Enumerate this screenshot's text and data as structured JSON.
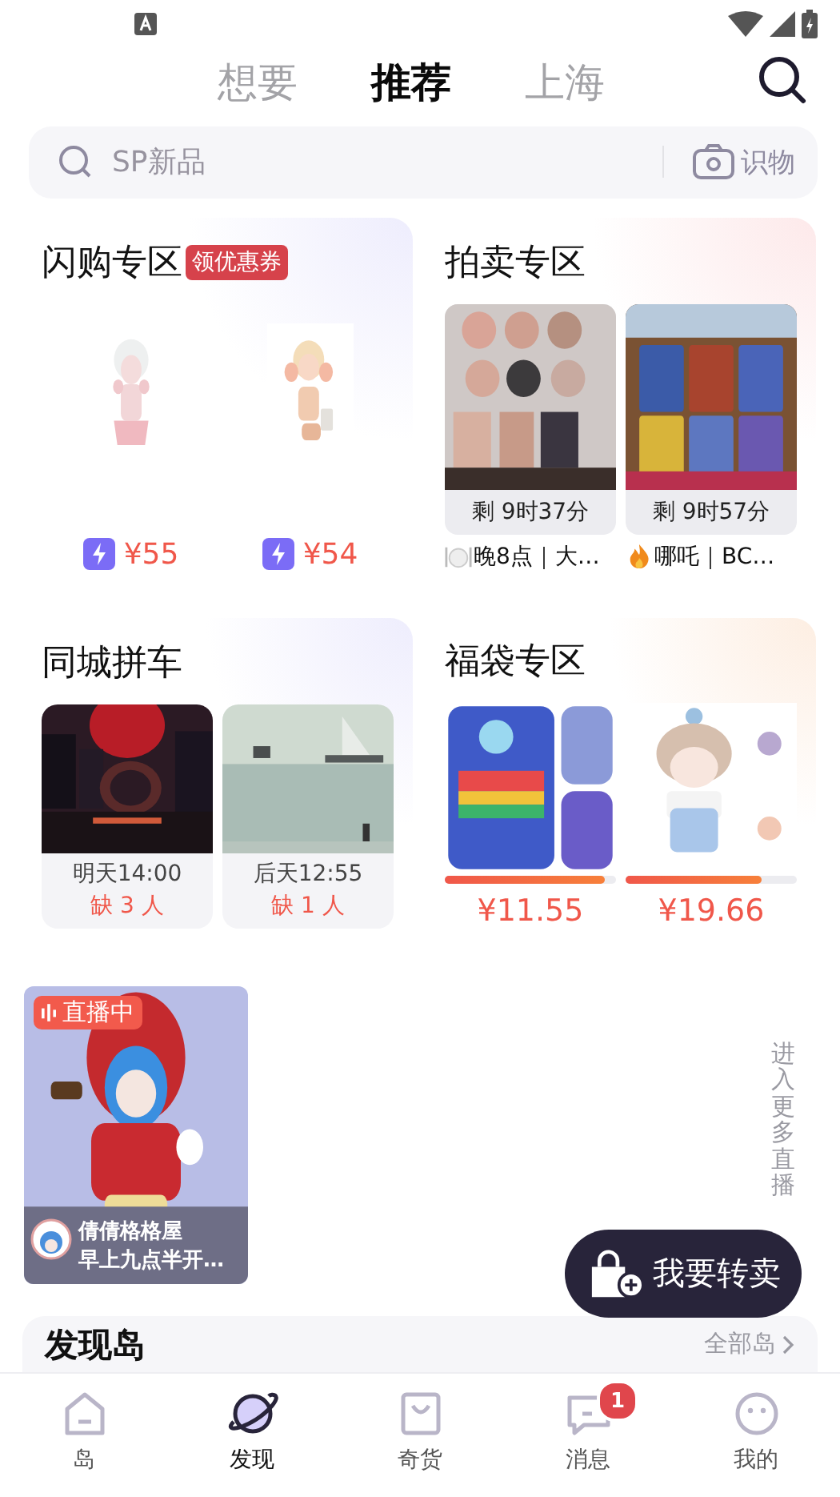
{
  "header_tabs": [
    {
      "label": "想要",
      "selected": false
    },
    {
      "label": "推荐",
      "selected": true
    },
    {
      "label": "上海",
      "selected": false
    }
  ],
  "search": {
    "placeholder": "SP新品",
    "image_search_label": "识物"
  },
  "sections": [
    {
      "kind": "flash",
      "title": "闪购专区",
      "tag": "领优惠券",
      "items": [
        {
          "price": "¥55"
        },
        {
          "price": "¥54"
        }
      ]
    },
    {
      "kind": "auction",
      "title": "拍卖专区",
      "items": [
        {
          "countdown": "剩 9时37分",
          "caption": "晚8点｜大…"
        },
        {
          "countdown": "剩 9时57分",
          "caption": "哪吒｜BC…"
        }
      ]
    },
    {
      "kind": "carpool",
      "title": "同城拼车",
      "items": [
        {
          "time": "明天14:00",
          "need": "缺 3 人"
        },
        {
          "time": "后天12:55",
          "need": "缺 1 人"
        }
      ]
    },
    {
      "kind": "lucky_bag",
      "title": "福袋专区",
      "items": [
        {
          "level": 0.93,
          "price": "¥11.55"
        },
        {
          "level": 0.79,
          "price": "¥19.66"
        }
      ]
    }
  ],
  "live": {
    "badge": "直播中",
    "streamer": "倩倩格格屋",
    "subtitle": "早上九点半开…",
    "more": "进入更多直播"
  },
  "resell_button": "我要转卖",
  "discover": {
    "title": "发现岛",
    "more": "全部岛"
  },
  "bottom_tabs": [
    {
      "label": "岛",
      "selected": false
    },
    {
      "label": "发现",
      "selected": true
    },
    {
      "label": "奇货",
      "selected": false
    },
    {
      "label": "消息",
      "selected": false,
      "badge": "1"
    },
    {
      "label": "我的",
      "selected": false
    }
  ]
}
